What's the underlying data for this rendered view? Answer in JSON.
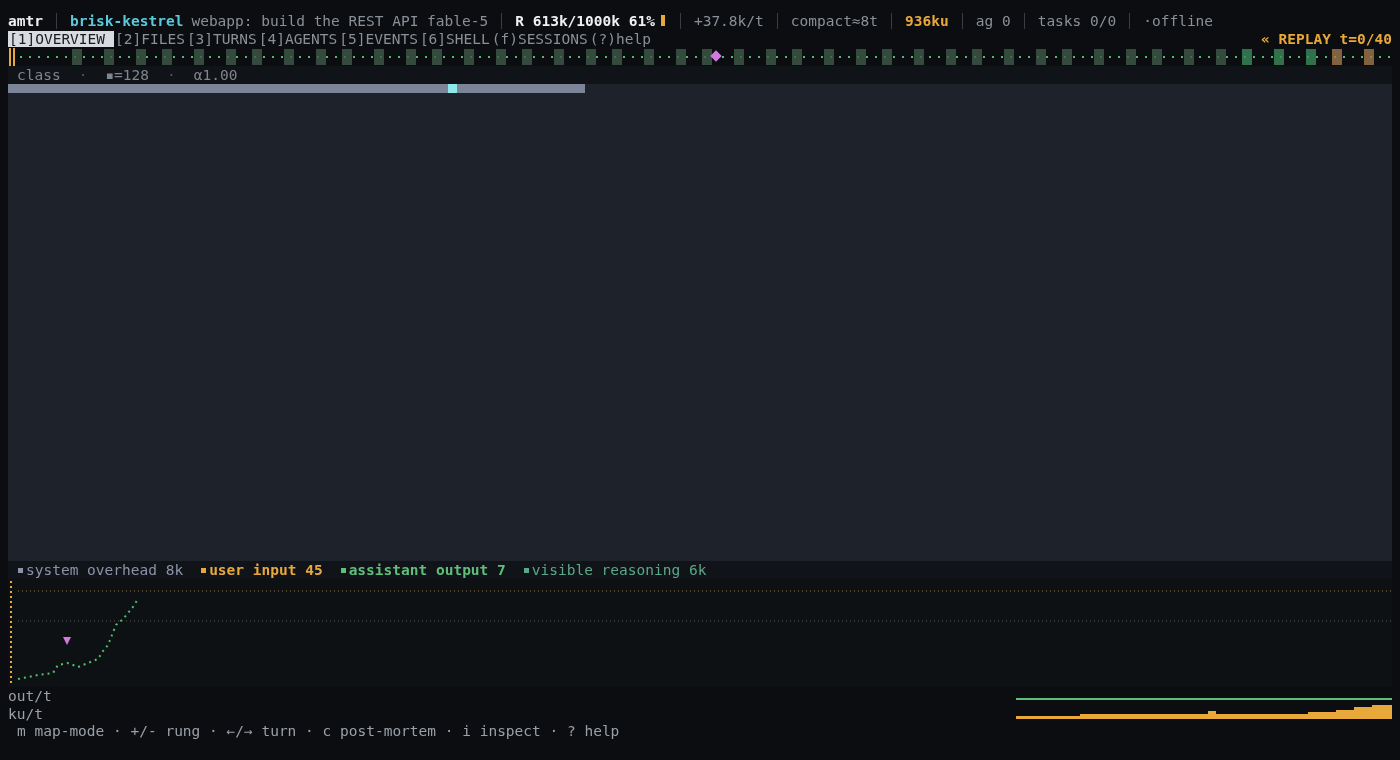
{
  "status_bar": [
    {
      "kind": "app",
      "text": "amtr"
    },
    {
      "kind": "session",
      "text": "brisk-kestrel",
      "detail": "webapp: build the REST API fable-5"
    },
    {
      "kind": "budget",
      "text": "R 613k/1000k 61%"
    },
    {
      "kind": "muted",
      "text": "+37.8k/t"
    },
    {
      "kind": "muted",
      "text": "compact≈8t"
    },
    {
      "kind": "accent",
      "text": "936ku"
    },
    {
      "kind": "muted",
      "text": "ag 0"
    },
    {
      "kind": "muted",
      "text": "tasks 0/0"
    },
    {
      "kind": "muted",
      "text": "·offline"
    }
  ],
  "tabs": [
    {
      "label": "[1]OVERVIEW",
      "selected": true
    },
    {
      "label": "[2]FILES",
      "selected": false
    },
    {
      "label": "[3]TURNS",
      "selected": false
    },
    {
      "label": "[4]AGENTS",
      "selected": false
    },
    {
      "label": "[5]EVENTS",
      "selected": false
    },
    {
      "label": "[6]SHELL",
      "selected": false
    },
    {
      "label": "(f)SESSIONS",
      "selected": false
    },
    {
      "label": "(?)help",
      "selected": false
    }
  ],
  "replay": "« REPLAY t=0/40",
  "map_header": [
    "class",
    "·",
    "▪=128",
    "·",
    "α1.00"
  ],
  "legend": [
    {
      "label": "system overhead 8k",
      "color": "#8c93a8",
      "emphasized": false
    },
    {
      "label": "user input 45",
      "color": "#e8a83a",
      "emphasized": true
    },
    {
      "label": "assistant output 7",
      "color": "#5fbf7a",
      "emphasized": true
    },
    {
      "label": "visible reasoning 6k",
      "color": "#5aa888",
      "emphasized": false
    }
  ],
  "rate_labels": [
    "out/t",
    "ku/t"
  ],
  "help": "m map-mode · +/- rung · ←/→ turn · c post-mortem · i inspect · ? help"
}
